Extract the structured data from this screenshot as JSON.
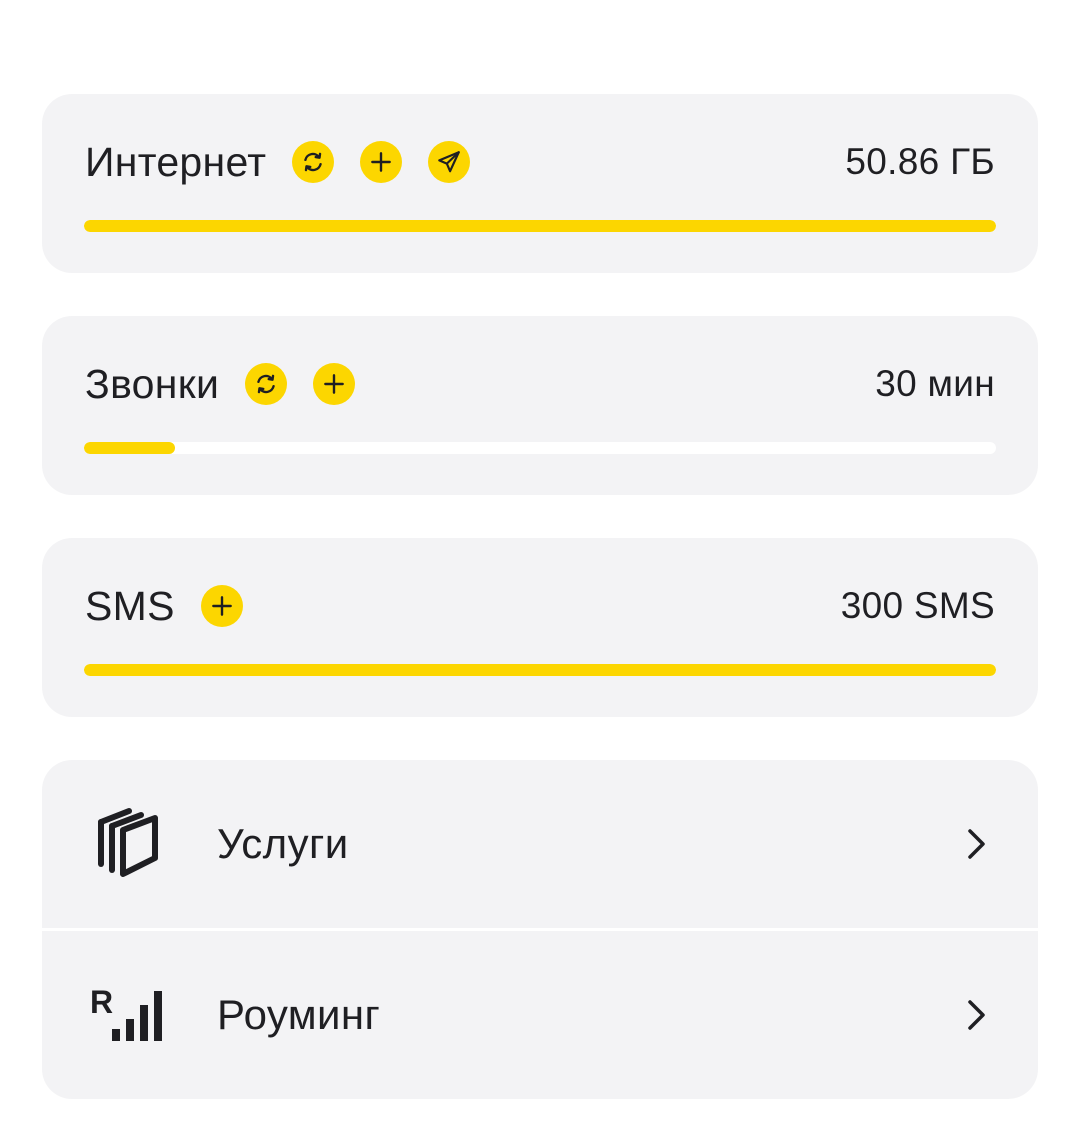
{
  "quotas": {
    "internet": {
      "title": "Интернет",
      "amount": "50.86 ГБ",
      "progress": 1.0,
      "actions": [
        "refresh-icon",
        "plus-icon",
        "send-icon"
      ]
    },
    "calls": {
      "title": "Звонки",
      "amount": "30 мин",
      "progress": 0.1,
      "actions": [
        "refresh-icon",
        "plus-icon"
      ]
    },
    "sms": {
      "title": "SMS",
      "amount": "300 SMS",
      "progress": 1.0,
      "actions": [
        "plus-icon"
      ]
    }
  },
  "menu": {
    "items": [
      {
        "label": "Услуги",
        "icon": "services-stack-icon"
      },
      {
        "label": "Роуминг",
        "icon": "roaming-signal-icon"
      }
    ]
  },
  "colors": {
    "accent": "#fcd600",
    "card_bg": "#f3f3f5",
    "text": "#1f1f23"
  }
}
